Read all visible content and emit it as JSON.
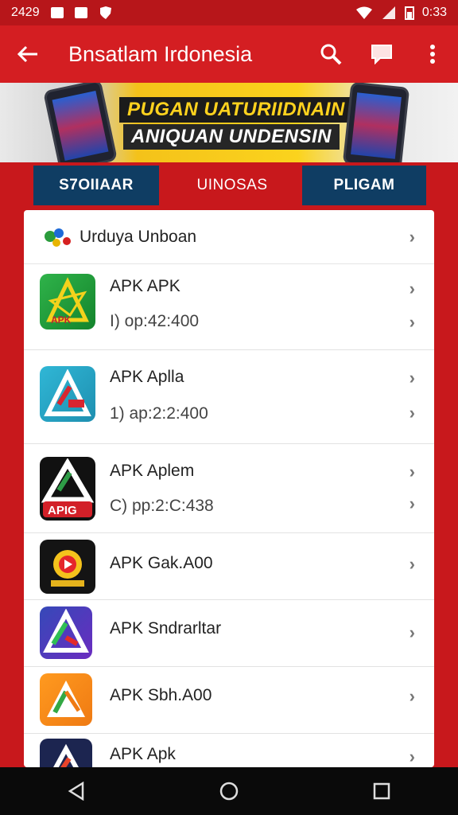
{
  "status_bar": {
    "left_time": "2429",
    "clock": "0:33"
  },
  "header": {
    "title": "Bnsatlam Irdonesia"
  },
  "banner": {
    "line1": "PUGAN UATURIIDNAIN",
    "line2": "ANIQUAN UNDENSIN"
  },
  "tabs": [
    {
      "label": "S7OIIAAR"
    },
    {
      "label": "UINOSAS"
    },
    {
      "label": "PLIGAM"
    }
  ],
  "section": {
    "title": "Urduya Unboan"
  },
  "apps": [
    {
      "name": "APK APK",
      "meta": "I) op:42:400",
      "icon_text": "APK"
    },
    {
      "name": "APK Aplla",
      "meta": "1) ap:2:2:400"
    },
    {
      "name": "APK Aplem",
      "meta": "C) pp:2:C:438",
      "icon_text": "APIG"
    },
    {
      "name": "APK Gak.A00",
      "meta": ""
    },
    {
      "name": "APK Sndrarltar",
      "meta": ""
    },
    {
      "name": "APK Sbh.A00",
      "meta": ""
    },
    {
      "name": "APK Apk",
      "meta": ""
    }
  ],
  "icons": {
    "back": "arrow-left-icon",
    "search": "search-icon",
    "message": "message-icon",
    "more": "more-vert-icon",
    "nav_back": "triangle-back-icon",
    "nav_home": "circle-home-icon",
    "nav_recent": "square-recent-icon"
  },
  "colors": {
    "brand_red": "#d41e22",
    "tab_dark": "#0f3d63",
    "banner_yellow": "#fbd31d"
  }
}
